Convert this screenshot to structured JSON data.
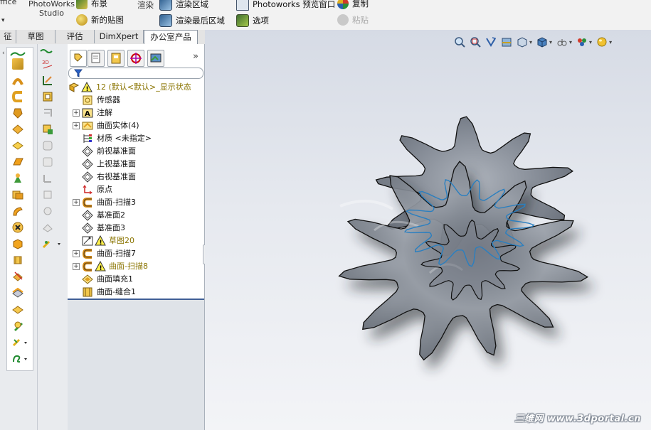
{
  "ribbon": {
    "partial_office": "ffice",
    "photoworks_studio": "PhotoWorks\nStudio",
    "scene": "布景",
    "render": "渲染",
    "render_region": "渲染区域",
    "photoworks_preview": "Photoworks 预览窗口",
    "copy": "复制",
    "new_decal": "新的贴图",
    "render_last_region": "渲染最后区域",
    "options": "选项",
    "paste": "粘贴"
  },
  "tabs": [
    "征",
    "草图",
    "评估",
    "DimXpert",
    "办公室产品"
  ],
  "active_tab_index": 4,
  "feature_tree": {
    "root": "12  (默认<默认>_显示状态",
    "items": [
      {
        "label": "传感器",
        "icon": "sensor-icon",
        "expand": false,
        "warn": false
      },
      {
        "label": "注解",
        "icon": "annotation-icon",
        "expand": true,
        "warn": false
      },
      {
        "label": "曲面实体(4)",
        "icon": "surface-bodies-icon",
        "expand": true,
        "warn": false
      },
      {
        "label": "材质 <未指定>",
        "icon": "material-icon",
        "expand": false,
        "warn": false
      },
      {
        "label": "前视基准面",
        "icon": "plane-icon",
        "expand": false,
        "warn": false
      },
      {
        "label": "上视基准面",
        "icon": "plane-icon",
        "expand": false,
        "warn": false
      },
      {
        "label": "右视基准面",
        "icon": "plane-icon",
        "expand": false,
        "warn": false
      },
      {
        "label": "原点",
        "icon": "origin-icon",
        "expand": false,
        "warn": false
      },
      {
        "label": "曲面-扫描3",
        "icon": "sweep-surface-icon",
        "expand": true,
        "warn": false
      },
      {
        "label": "基准面2",
        "icon": "plane-icon",
        "expand": false,
        "warn": false
      },
      {
        "label": "基准面3",
        "icon": "plane-icon",
        "expand": false,
        "warn": false
      },
      {
        "label": "草图20",
        "icon": "sketch-icon",
        "expand": false,
        "warn": true
      },
      {
        "label": "曲面-扫描7",
        "icon": "sweep-surface-icon",
        "expand": true,
        "warn": false
      },
      {
        "label": "曲面-扫描8",
        "icon": "sweep-surface-icon",
        "expand": true,
        "warn": true
      },
      {
        "label": "曲面填充1",
        "icon": "fill-surface-icon",
        "expand": false,
        "warn": false
      },
      {
        "label": "曲面-缝合1",
        "icon": "knit-surface-icon",
        "expand": false,
        "warn": false
      }
    ]
  },
  "watermark": "三维网 www.3dportal.cn",
  "colors": {
    "accent": "#3f5f96",
    "warning": "#8a7400",
    "surface": "#5f6670",
    "viewport_top": "#d6dbe5"
  }
}
